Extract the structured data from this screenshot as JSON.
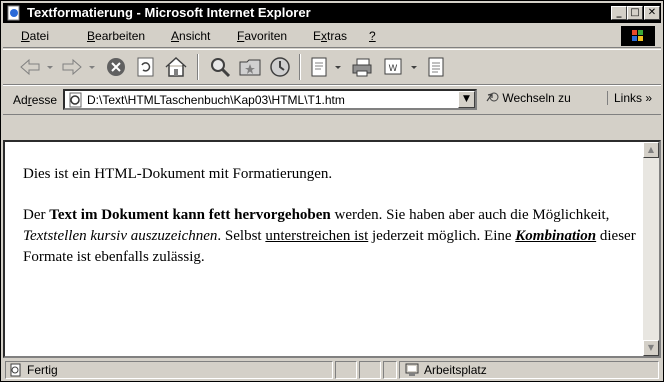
{
  "window": {
    "title": "Textformatierung - Microsoft Internet Explorer",
    "minimize": "_",
    "maximize": "□",
    "close": "✕"
  },
  "menu": {
    "items": [
      {
        "first": "D",
        "rest": "atei"
      },
      {
        "first": "B",
        "rest": "earbeiten"
      },
      {
        "first": "A",
        "rest": "nsicht"
      },
      {
        "first": "F",
        "rest": "avoriten"
      },
      {
        "first": "E",
        "mid": "x",
        "rest": "tras"
      },
      {
        "first": "?",
        "rest": ""
      }
    ]
  },
  "toolbar": {
    "icons": [
      "back-icon",
      "forward-icon",
      "stop-icon",
      "refresh-icon",
      "home-icon",
      "search-icon",
      "favorites-icon",
      "history-icon",
      "mail-icon",
      "print-icon",
      "edit-icon",
      "discuss-icon"
    ]
  },
  "address": {
    "label_pre": "Ad",
    "label_u": "r",
    "label_post": "esse",
    "url": "D:\\Text\\HTMLTaschenbuch\\Kap03\\HTML\\T1.htm",
    "go_label": "Wechseln zu",
    "links_label": "Links »"
  },
  "document": {
    "p1": "Dies ist ein HTML-Dokument mit Formatierungen.",
    "p2_a": "Der ",
    "p2_bold": "Text im Dokument kann fett hervorgehoben",
    "p2_b": " werden. Sie haben aber auch die Möglichkeit, ",
    "p2_italic": "Textstellen kursiv auszuzeichnen",
    "p2_c": ". Selbst ",
    "p2_underline": "unterstreichen ist",
    "p2_d": " jederzeit möglich. Eine ",
    "p2_combo": "Kombination",
    "p2_e": " dieser Formate ist ebenfalls zulässig."
  },
  "status": {
    "text": "Fertig",
    "zone": "Arbeitsplatz"
  }
}
